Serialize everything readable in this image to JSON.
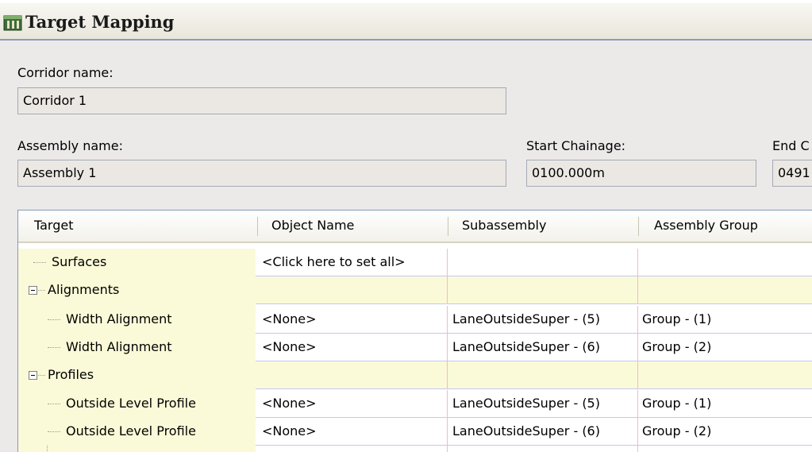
{
  "window": {
    "title": "Target Mapping"
  },
  "form": {
    "corridor_label": "Corridor name:",
    "corridor_value": "Corridor 1",
    "assembly_label": "Assembly name:",
    "assembly_value": "Assembly 1",
    "start_label": "Start Chainage:",
    "start_value": "0100.000m",
    "end_label": "End C",
    "end_value": "0491"
  },
  "grid": {
    "columns": [
      "Target",
      "Object Name",
      "Subassembly",
      "Assembly Group"
    ],
    "rows": [
      {
        "target": "Surfaces",
        "object": "<Click here to set all>",
        "sub": "",
        "group": ""
      },
      {
        "target": "Alignments",
        "object": "",
        "sub": "",
        "group": ""
      },
      {
        "target": "Width Alignment",
        "object": "<None>",
        "sub": "LaneOutsideSuper - (5)",
        "group": "Group - (1)"
      },
      {
        "target": "Width Alignment",
        "object": "<None>",
        "sub": "LaneOutsideSuper - (6)",
        "group": "Group - (2)"
      },
      {
        "target": "Profiles",
        "object": "",
        "sub": "",
        "group": ""
      },
      {
        "target": "Outside Level Profile",
        "object": "<None>",
        "sub": "LaneOutsideSuper - (5)",
        "group": "Group - (1)"
      },
      {
        "target": "Outside Level Profile",
        "object": "<None>",
        "sub": "LaneOutsideSuper - (6)",
        "group": "Group - (2)"
      }
    ]
  }
}
